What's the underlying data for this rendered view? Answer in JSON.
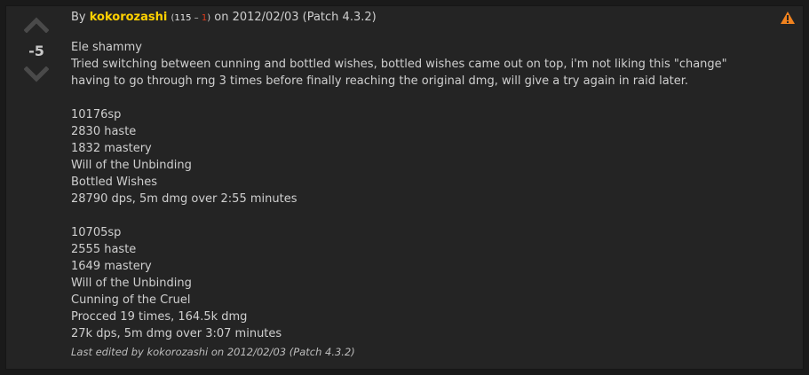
{
  "vote": {
    "score": "-5",
    "up_icon": "chevron-up-icon",
    "down_icon": "chevron-down-icon"
  },
  "report": {
    "icon": "warning-icon",
    "color": "#f0821e"
  },
  "byline": {
    "prefix": "By ",
    "author": "kokorozashi",
    "rep_open": "(",
    "rep_up": "115",
    "rep_sep": " – ",
    "rep_down": "1",
    "rep_close": ")",
    "date_text": " on 2012/02/03 (Patch 4.3.2)"
  },
  "comment": {
    "lines": [
      "Ele shammy",
      "Tried switching between cunning and bottled wishes, bottled wishes came out on top, i'm not liking this \"change\" having to go through rng 3 times before finally reaching the original dmg, will give a try again in raid later.",
      "",
      "10176sp",
      "2830 haste",
      "1832 mastery",
      "Will of the Unbinding",
      "Bottled Wishes",
      "28790 dps, 5m dmg over 2:55 minutes",
      "",
      "10705sp",
      "2555 haste",
      "1649 mastery",
      "Will of the Unbinding",
      "Cunning of the Cruel",
      "Procced 19 times, 164.5k dmg",
      "27k dps, 5m dmg over 3:07 minutes"
    ]
  },
  "edited": "Last edited by kokorozashi on 2012/02/03 (Patch 4.3.2)",
  "colors": {
    "author": "#ffd100",
    "downvote_rep": "#e23a1b",
    "background": "#242424"
  }
}
